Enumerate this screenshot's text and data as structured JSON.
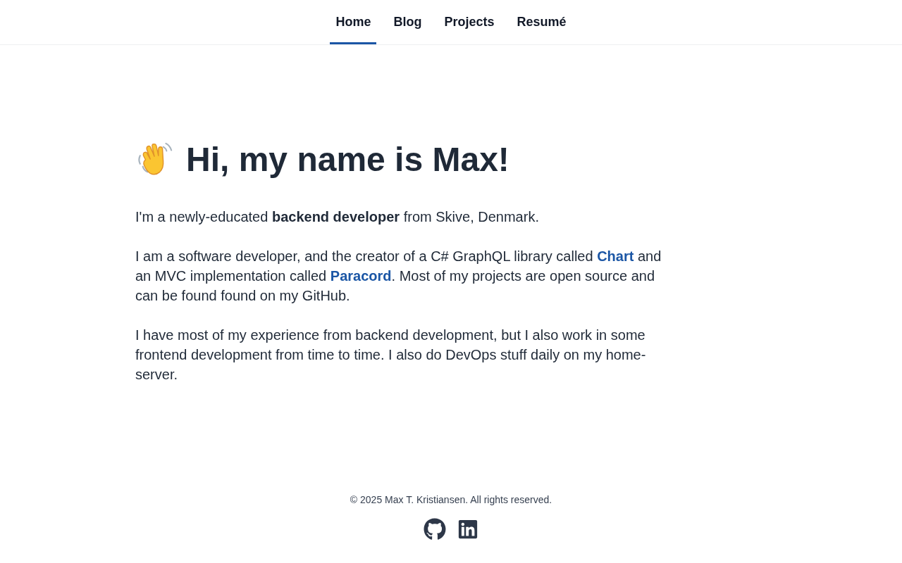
{
  "nav": {
    "tabs": [
      {
        "label": "Home",
        "selected": true
      },
      {
        "label": "Blog",
        "selected": false
      },
      {
        "label": "Projects",
        "selected": false
      },
      {
        "label": "Resumé",
        "selected": false
      }
    ]
  },
  "intro": {
    "heading": "Hi, my name is Max!",
    "paragraphs": [
      {
        "parts": [
          {
            "kind": "text",
            "text": "I'm a newly-educated **backend developer** from Skive, Denmark."
          }
        ]
      },
      {
        "parts": [
          {
            "kind": "text",
            "text": "I am a software developer, and the creator of a C# GraphQL library called "
          },
          {
            "kind": "link",
            "text": "Chart"
          },
          {
            "kind": "text",
            "text": " and an MVC implementation called "
          },
          {
            "kind": "link",
            "text": "Paracord"
          },
          {
            "kind": "text",
            "text": ". Most of my projects are open source and can be found found on my GitHub."
          }
        ]
      },
      {
        "parts": [
          {
            "kind": "text",
            "text": "I have most of my experience from backend development, but I also work in some frontend development from time to time. I also do DevOps stuff daily on my home-server."
          }
        ]
      }
    ]
  },
  "footer": {
    "copyright": "© 2025 Max T. Kristiansen. All rights reserved."
  }
}
